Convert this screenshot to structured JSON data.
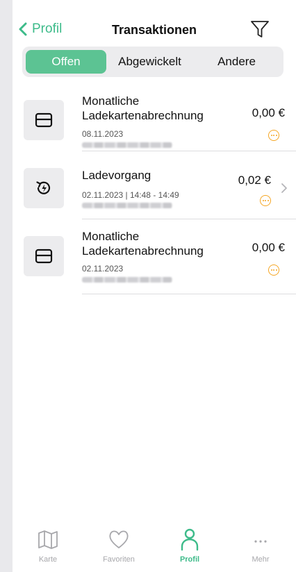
{
  "header": {
    "back_label": "Profil",
    "title": "Transaktionen",
    "filter_icon": "filter-icon"
  },
  "segments": [
    {
      "label": "Offen",
      "active": true
    },
    {
      "label": "Abgewickelt",
      "active": false
    },
    {
      "label": "Andere",
      "active": false
    }
  ],
  "transactions": [
    {
      "name": "Monatliche Ladekartenabrechnung",
      "date": "08.11.2023",
      "amount": "0,00 €",
      "icon": "card-icon",
      "status_icon": "more-circle-icon"
    },
    {
      "name": "Ladevorgang",
      "date": "02.11.2023 | 14:48 - 14:49",
      "amount": "0,02 €",
      "icon": "charging-history-icon",
      "status_icon": "more-circle-icon",
      "has_chevron": true
    },
    {
      "name": "Monatliche Ladekartenabrechnung",
      "date": "02.11.2023",
      "amount": "0,00 €",
      "icon": "card-icon",
      "status_icon": "more-circle-icon"
    }
  ],
  "tabbar": [
    {
      "label": "Karte",
      "icon": "map-icon",
      "active": false
    },
    {
      "label": "Favoriten",
      "icon": "heart-icon",
      "active": false
    },
    {
      "label": "Profil",
      "icon": "person-icon",
      "active": true
    },
    {
      "label": "Mehr",
      "icon": "ellipsis-icon",
      "active": false
    }
  ],
  "colors": {
    "accent": "#3dbb8a",
    "segment_active": "#5cc393",
    "status": "#f5a623"
  }
}
